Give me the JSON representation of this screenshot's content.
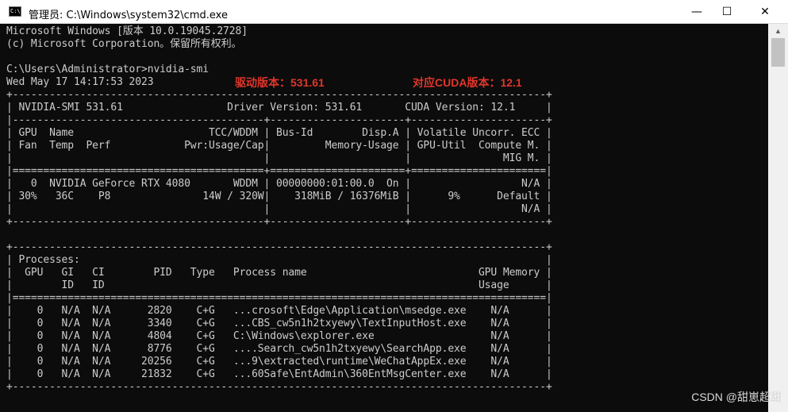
{
  "window": {
    "title": "管理员: C:\\Windows\\system32\\cmd.exe",
    "icon": "cmd-icon",
    "minimize_icon": "—",
    "maximize_icon": "☐",
    "close_icon": "✕"
  },
  "console": {
    "lines": [
      "Microsoft Windows [版本 10.0.19045.2728]",
      "(c) Microsoft Corporation。保留所有权利。",
      "",
      "C:\\Users\\Administrator>nvidia-smi",
      "Wed May 17 14:17:53 2023",
      "+---------------------------------------------------------------------------------------+",
      "| NVIDIA-SMI 531.61                 Driver Version: 531.61       CUDA Version: 12.1     |",
      "|-----------------------------------------+----------------------+----------------------+",
      "| GPU  Name                      TCC/WDDM | Bus-Id        Disp.A | Volatile Uncorr. ECC |",
      "| Fan  Temp  Perf            Pwr:Usage/Cap|         Memory-Usage | GPU-Util  Compute M. |",
      "|                                         |                      |               MIG M. |",
      "|=========================================+======================+======================|",
      "|   0  NVIDIA GeForce RTX 4080       WDDM | 00000000:01:00.0  On |                  N/A |",
      "| 30%   36C    P8               14W / 320W|    318MiB / 16376MiB |      9%      Default |",
      "|                                         |                      |                  N/A |",
      "+-----------------------------------------+----------------------+----------------------+",
      "",
      "+---------------------------------------------------------------------------------------+",
      "| Processes:                                                                            |",
      "|  GPU   GI   CI        PID   Type   Process name                            GPU Memory |",
      "|        ID   ID                                                             Usage      |",
      "|=======================================================================================|",
      "|    0   N/A  N/A      2820    C+G   ...crosoft\\Edge\\Application\\msedge.exe    N/A      |",
      "|    0   N/A  N/A      3340    C+G   ...CBS_cw5n1h2txyewy\\TextInputHost.exe    N/A      |",
      "|    0   N/A  N/A      4804    C+G   C:\\Windows\\explorer.exe                   N/A      |",
      "|    0   N/A  N/A      8776    C+G   ....Search_cw5n1h2txyewy\\SearchApp.exe    N/A      |",
      "|    0   N/A  N/A     20256    C+G   ...9\\extracted\\runtime\\WeChatAppEx.exe    N/A      |",
      "|    0   N/A  N/A     21832    C+G   ...60Safe\\EntAdmin\\360EntMsgCenter.exe    N/A      |",
      "+---------------------------------------------------------------------------------------+"
    ]
  },
  "annotations": {
    "driver": "驱动版本：531.61",
    "cuda": "对应CUDA版本：12.1",
    "color": "#e0362b"
  },
  "watermark": "CSDN @甜崽超甜"
}
